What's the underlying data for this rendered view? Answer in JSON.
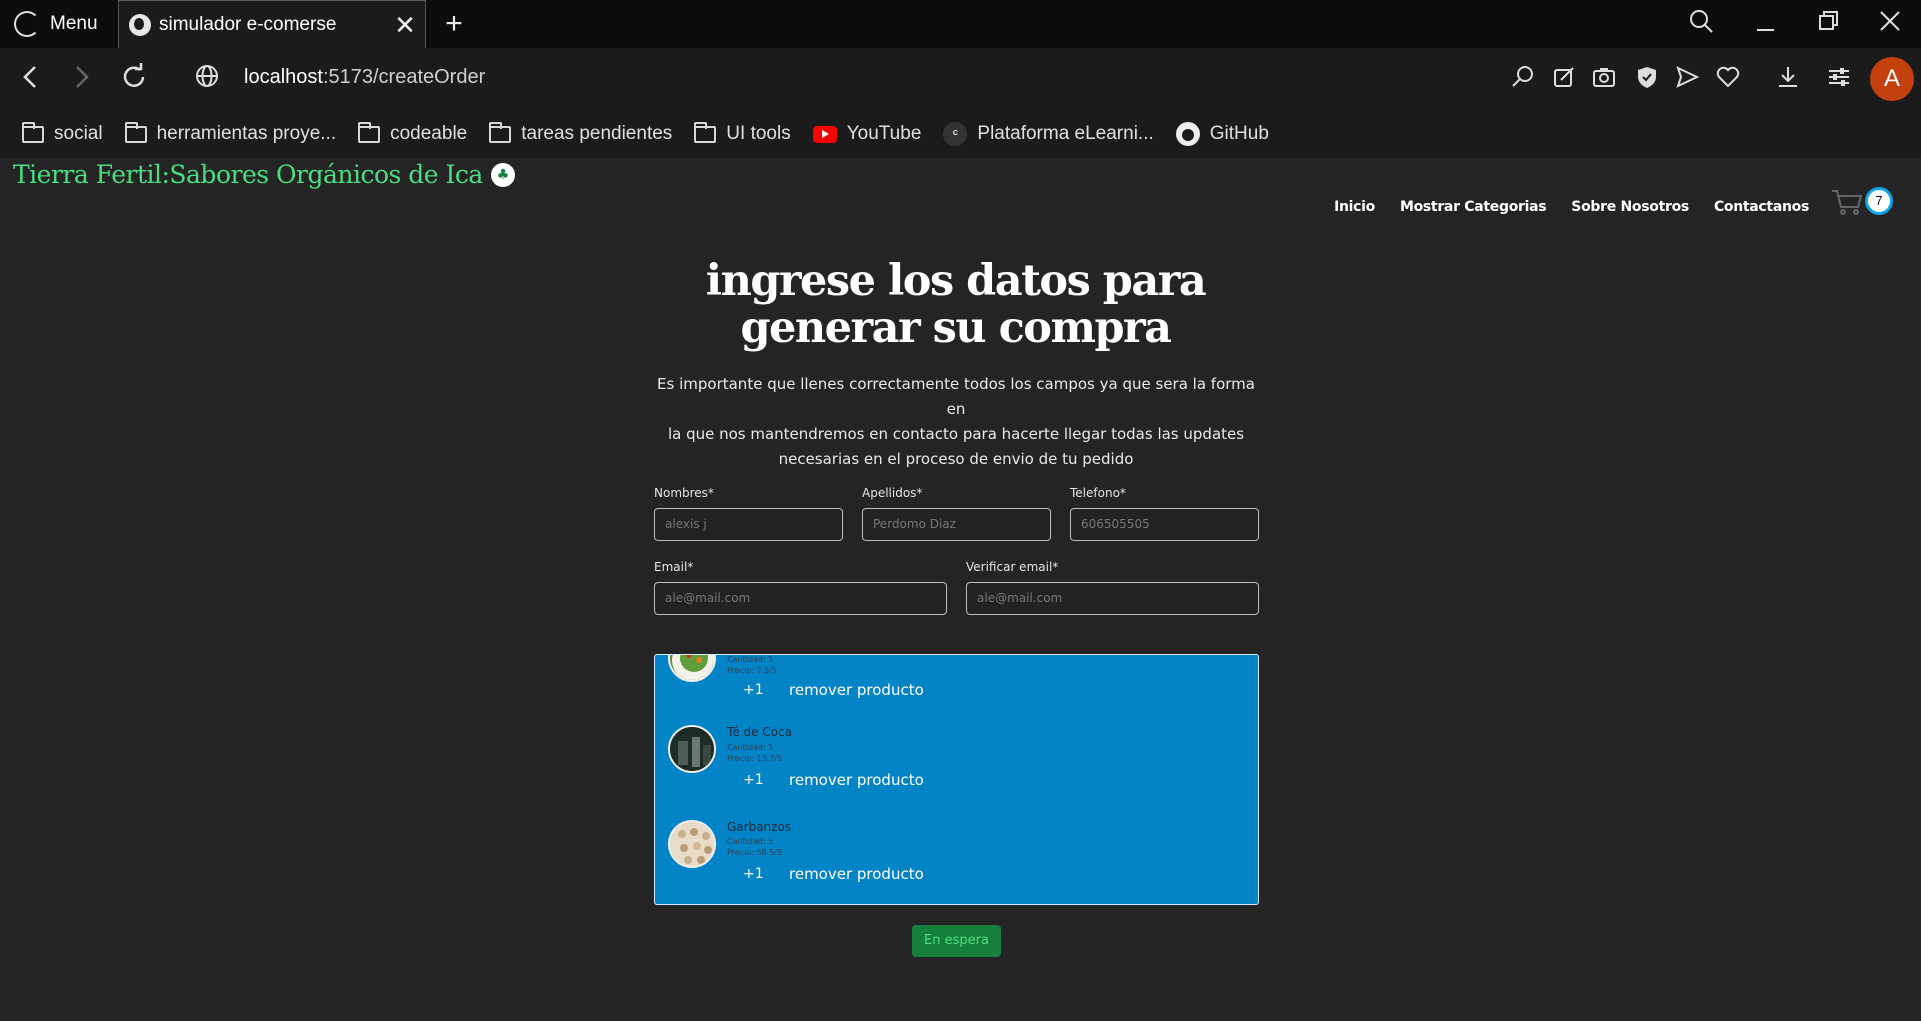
{
  "browser": {
    "menu_label": "Menu",
    "tab_title": "simulador e-comerse",
    "url_host": "localhost",
    "url_path": ":5173/createOrder",
    "profile_initial": "A",
    "bookmarks": [
      {
        "label": "social",
        "icon": "folder-icon"
      },
      {
        "label": "herramientas proye...",
        "icon": "folder-icon"
      },
      {
        "label": "codeable",
        "icon": "folder-icon"
      },
      {
        "label": "tareas pendientes",
        "icon": "folder-icon"
      },
      {
        "label": "UI tools",
        "icon": "folder-icon"
      },
      {
        "label": "YouTube",
        "icon": "youtube-icon"
      },
      {
        "label": "Plataforma eLearni...",
        "icon": "coder-icon"
      },
      {
        "label": "GitHub",
        "icon": "github-icon"
      }
    ]
  },
  "site": {
    "brand": "Tierra Fertil:Sabores Orgánicos de Ica",
    "nav": [
      "Inicio",
      "Mostrar Categorias",
      "Sobre Nosotros",
      "Contactanos"
    ],
    "cart_count": "7"
  },
  "form": {
    "headline_line1": "ingrese los datos para",
    "headline_line2": "generar su compra",
    "intro_line1": "Es importante que llenes correctamente todos los campos ya que sera la forma en",
    "intro_line2": "la que nos mantendremos en contacto para hacerte llegar todas las updates",
    "intro_line3": "necesarias en el proceso de envio de tu pedido",
    "fields": {
      "nombres_label": "Nombres*",
      "nombres_placeholder": "alexis j",
      "apellidos_label": "Apellidos*",
      "apellidos_placeholder": "Perdomo Diaz",
      "telefono_label": "Telefono*",
      "telefono_placeholder": "606505505",
      "email_label": "Email*",
      "email_placeholder": "ale@mail.com",
      "verify_label": "Verificar email*",
      "verify_placeholder": "ale@mail.com"
    },
    "products": [
      {
        "name": "",
        "qty": "Cantidad: 1",
        "price": "Precio: 7.5/5",
        "plus": "+1",
        "remove": "remover producto"
      },
      {
        "name": "Té de Coca",
        "qty": "Cantidad: 1",
        "price": "Precio: 13.7/5",
        "plus": "+1",
        "remove": "remover producto"
      },
      {
        "name": "Garbanzos",
        "qty": "Cantidad: 5",
        "price": "Precio: 58.5/5",
        "plus": "+1",
        "remove": "remover producto"
      }
    ],
    "submit_label": "En espera"
  }
}
